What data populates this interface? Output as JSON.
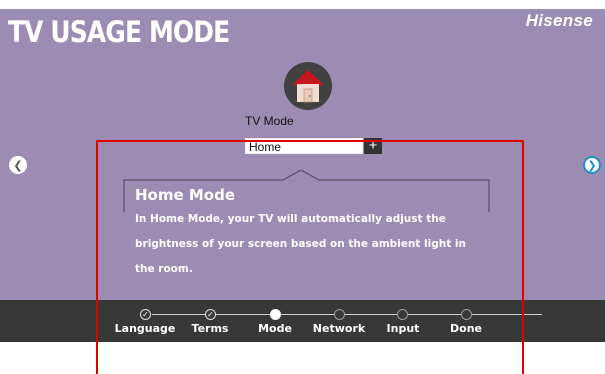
{
  "header": {
    "title": "TV USAGE MODE",
    "brand": "Hisense"
  },
  "mode_picker": {
    "icon": "house-icon",
    "label": "TV Mode",
    "value": "Home",
    "plus": "+"
  },
  "nav": {
    "prev_icon": "chevron-left-icon",
    "next_icon": "chevron-right-icon"
  },
  "description": {
    "title": "Home Mode",
    "lines": [
      "In Home Mode, your TV will automatically adjust the",
      "brightness of your screen based on the ambient light in",
      "the room."
    ]
  },
  "steps": [
    {
      "label": "Language",
      "state": "done"
    },
    {
      "label": "Terms",
      "state": "done"
    },
    {
      "label": "Mode",
      "state": "current"
    },
    {
      "label": "Network",
      "state": "future"
    },
    {
      "label": "Input",
      "state": "future"
    },
    {
      "label": "Done",
      "state": "future"
    }
  ],
  "colors": {
    "screen_bg": "#9c8bb3",
    "bar_bg": "#383838",
    "highlight": "#e00000",
    "accent": "#1f8fc7"
  }
}
